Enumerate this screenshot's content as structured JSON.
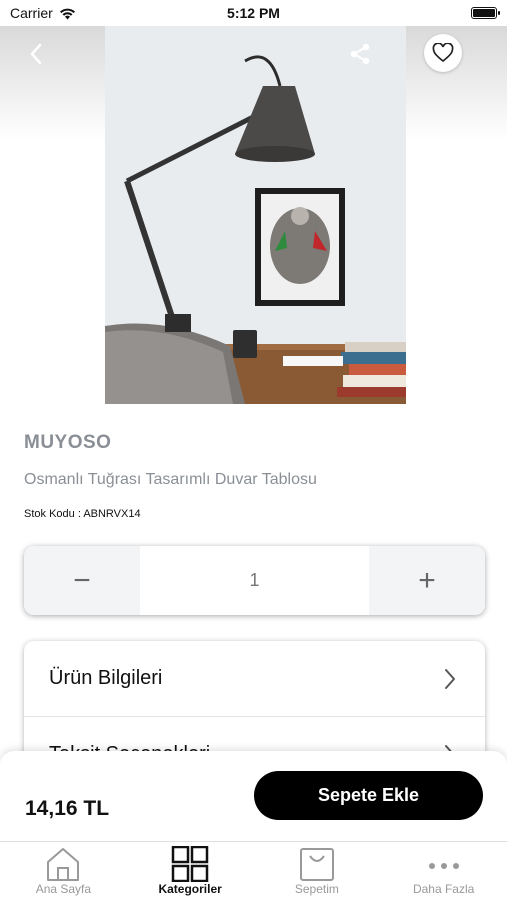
{
  "status_bar": {
    "carrier": "Carrier",
    "time": "5:12 PM"
  },
  "product": {
    "brand": "MUYOSO",
    "title": "Osmanlı Tuğrası Tasarımlı Duvar Tablosu",
    "stock_code": "Stok Kodu : ABNRVX14",
    "image_icon": "product-photo-lamp-desk"
  },
  "quantity": {
    "minus": "−",
    "value": "1",
    "plus": "+"
  },
  "info": {
    "rows": [
      {
        "label": "Ürün Bilgileri"
      },
      {
        "label": "Taksit Seçenekleri"
      }
    ]
  },
  "purchase": {
    "price": "14,16 TL",
    "button": "Sepete Ekle"
  },
  "tabs": [
    {
      "label": "Ana Sayfa",
      "icon": "home-icon"
    },
    {
      "label": "Kategoriler",
      "icon": "grid-icon"
    },
    {
      "label": "Sepetim",
      "icon": "shopping-bag-icon"
    },
    {
      "label": "Daha Fazla",
      "icon": "more-icon"
    }
  ]
}
